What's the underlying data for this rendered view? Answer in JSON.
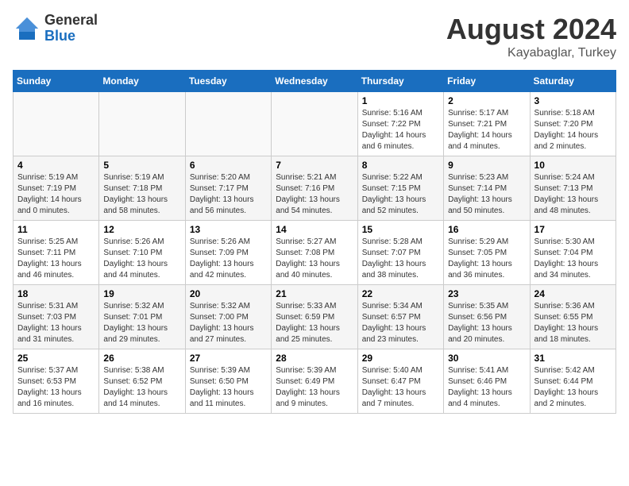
{
  "logo": {
    "general": "General",
    "blue": "Blue"
  },
  "header": {
    "month": "August 2024",
    "location": "Kayabaglar, Turkey"
  },
  "weekdays": [
    "Sunday",
    "Monday",
    "Tuesday",
    "Wednesday",
    "Thursday",
    "Friday",
    "Saturday"
  ],
  "weeks": [
    [
      {
        "day": "",
        "info": ""
      },
      {
        "day": "",
        "info": ""
      },
      {
        "day": "",
        "info": ""
      },
      {
        "day": "",
        "info": ""
      },
      {
        "day": "1",
        "info": "Sunrise: 5:16 AM\nSunset: 7:22 PM\nDaylight: 14 hours\nand 6 minutes."
      },
      {
        "day": "2",
        "info": "Sunrise: 5:17 AM\nSunset: 7:21 PM\nDaylight: 14 hours\nand 4 minutes."
      },
      {
        "day": "3",
        "info": "Sunrise: 5:18 AM\nSunset: 7:20 PM\nDaylight: 14 hours\nand 2 minutes."
      }
    ],
    [
      {
        "day": "4",
        "info": "Sunrise: 5:19 AM\nSunset: 7:19 PM\nDaylight: 14 hours\nand 0 minutes."
      },
      {
        "day": "5",
        "info": "Sunrise: 5:19 AM\nSunset: 7:18 PM\nDaylight: 13 hours\nand 58 minutes."
      },
      {
        "day": "6",
        "info": "Sunrise: 5:20 AM\nSunset: 7:17 PM\nDaylight: 13 hours\nand 56 minutes."
      },
      {
        "day": "7",
        "info": "Sunrise: 5:21 AM\nSunset: 7:16 PM\nDaylight: 13 hours\nand 54 minutes."
      },
      {
        "day": "8",
        "info": "Sunrise: 5:22 AM\nSunset: 7:15 PM\nDaylight: 13 hours\nand 52 minutes."
      },
      {
        "day": "9",
        "info": "Sunrise: 5:23 AM\nSunset: 7:14 PM\nDaylight: 13 hours\nand 50 minutes."
      },
      {
        "day": "10",
        "info": "Sunrise: 5:24 AM\nSunset: 7:13 PM\nDaylight: 13 hours\nand 48 minutes."
      }
    ],
    [
      {
        "day": "11",
        "info": "Sunrise: 5:25 AM\nSunset: 7:11 PM\nDaylight: 13 hours\nand 46 minutes."
      },
      {
        "day": "12",
        "info": "Sunrise: 5:26 AM\nSunset: 7:10 PM\nDaylight: 13 hours\nand 44 minutes."
      },
      {
        "day": "13",
        "info": "Sunrise: 5:26 AM\nSunset: 7:09 PM\nDaylight: 13 hours\nand 42 minutes."
      },
      {
        "day": "14",
        "info": "Sunrise: 5:27 AM\nSunset: 7:08 PM\nDaylight: 13 hours\nand 40 minutes."
      },
      {
        "day": "15",
        "info": "Sunrise: 5:28 AM\nSunset: 7:07 PM\nDaylight: 13 hours\nand 38 minutes."
      },
      {
        "day": "16",
        "info": "Sunrise: 5:29 AM\nSunset: 7:05 PM\nDaylight: 13 hours\nand 36 minutes."
      },
      {
        "day": "17",
        "info": "Sunrise: 5:30 AM\nSunset: 7:04 PM\nDaylight: 13 hours\nand 34 minutes."
      }
    ],
    [
      {
        "day": "18",
        "info": "Sunrise: 5:31 AM\nSunset: 7:03 PM\nDaylight: 13 hours\nand 31 minutes."
      },
      {
        "day": "19",
        "info": "Sunrise: 5:32 AM\nSunset: 7:01 PM\nDaylight: 13 hours\nand 29 minutes."
      },
      {
        "day": "20",
        "info": "Sunrise: 5:32 AM\nSunset: 7:00 PM\nDaylight: 13 hours\nand 27 minutes."
      },
      {
        "day": "21",
        "info": "Sunrise: 5:33 AM\nSunset: 6:59 PM\nDaylight: 13 hours\nand 25 minutes."
      },
      {
        "day": "22",
        "info": "Sunrise: 5:34 AM\nSunset: 6:57 PM\nDaylight: 13 hours\nand 23 minutes."
      },
      {
        "day": "23",
        "info": "Sunrise: 5:35 AM\nSunset: 6:56 PM\nDaylight: 13 hours\nand 20 minutes."
      },
      {
        "day": "24",
        "info": "Sunrise: 5:36 AM\nSunset: 6:55 PM\nDaylight: 13 hours\nand 18 minutes."
      }
    ],
    [
      {
        "day": "25",
        "info": "Sunrise: 5:37 AM\nSunset: 6:53 PM\nDaylight: 13 hours\nand 16 minutes."
      },
      {
        "day": "26",
        "info": "Sunrise: 5:38 AM\nSunset: 6:52 PM\nDaylight: 13 hours\nand 14 minutes."
      },
      {
        "day": "27",
        "info": "Sunrise: 5:39 AM\nSunset: 6:50 PM\nDaylight: 13 hours\nand 11 minutes."
      },
      {
        "day": "28",
        "info": "Sunrise: 5:39 AM\nSunset: 6:49 PM\nDaylight: 13 hours\nand 9 minutes."
      },
      {
        "day": "29",
        "info": "Sunrise: 5:40 AM\nSunset: 6:47 PM\nDaylight: 13 hours\nand 7 minutes."
      },
      {
        "day": "30",
        "info": "Sunrise: 5:41 AM\nSunset: 6:46 PM\nDaylight: 13 hours\nand 4 minutes."
      },
      {
        "day": "31",
        "info": "Sunrise: 5:42 AM\nSunset: 6:44 PM\nDaylight: 13 hours\nand 2 minutes."
      }
    ]
  ]
}
